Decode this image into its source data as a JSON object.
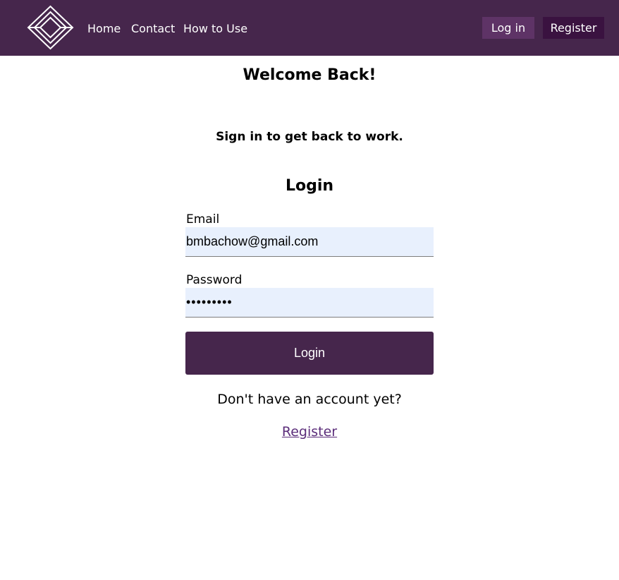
{
  "nav": {
    "logo_icon": "diamond-logo-icon",
    "links": [
      "Home",
      "Contact",
      "How to Use"
    ],
    "login_label": "Log in",
    "register_label": "Register"
  },
  "main": {
    "welcome": "Welcome Back!",
    "subtitle": "Sign in to get back to work.",
    "form_title": "Login",
    "email_label": "Email",
    "email_value": "bmbachow@gmail.com",
    "password_label": "Password",
    "password_value": "•••••••••",
    "submit_label": "Login",
    "no_account_text": "Don't have an account yet?",
    "register_link": "Register"
  },
  "colors": {
    "nav_bg": "#46264c",
    "login_btn_bg": "#5e3366",
    "register_btn_bg": "#3a1240",
    "field_bg": "#e8f0fd",
    "link": "#5b2d7a"
  }
}
